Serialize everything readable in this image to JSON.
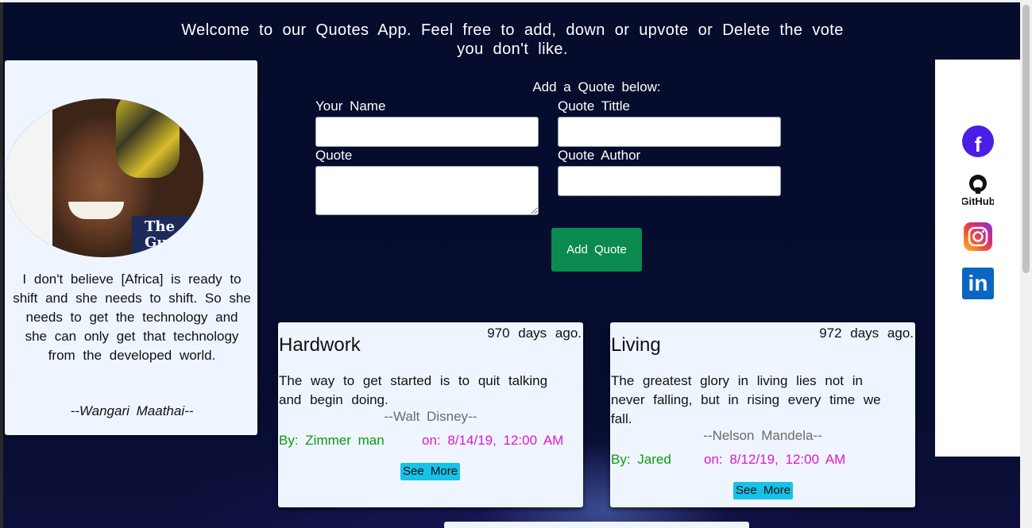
{
  "header": {
    "welcome": "Welcome to our Quotes App. Feel free to add, down or upvote or Delete the vote you don't like."
  },
  "featured": {
    "image_logo": "The Guardian",
    "quote": "I don't believe [Africa] is ready to shift and she needs to shift. So she needs to get the technology and she can only get that technology from the developed world.",
    "author": "--Wangari Maathai--"
  },
  "form": {
    "heading": "Add a Quote below:",
    "name_label": "Your Name",
    "title_label": "Quote Tittle",
    "quote_label": "Quote",
    "author_label": "Quote Author",
    "name_value": "",
    "title_value": "",
    "quote_value": "",
    "author_value": "",
    "submit_label": "Add Quote"
  },
  "quotes": [
    {
      "ago": "970 days ago.",
      "title": "Hardwork",
      "text": "The way to get started is to quit talking and begin doing.",
      "author": "--Walt Disney--",
      "by": "By: Zimmer man",
      "on": "on: 8/14/19, 12:00 AM",
      "see_more": "See More"
    },
    {
      "ago": "972 days ago.",
      "title": "Living",
      "text": "The greatest glory in living lies not in never falling, but in rising every time we fall.",
      "author": "--Nelson Mandela--",
      "by": "By: Jared",
      "on": "on: 8/12/19, 12:00 AM",
      "see_more": "See More"
    }
  ],
  "social": {
    "facebook": "facebook-icon",
    "github": "GitHub",
    "instagram": "instagram-icon",
    "linkedin": "in"
  },
  "colors": {
    "background": "#060d2e",
    "card": "#eef5ff",
    "button": "#0a8a4e",
    "by_text": "#0e9a0e",
    "date_text": "#e018c8",
    "see_more": "#17c1e8"
  }
}
